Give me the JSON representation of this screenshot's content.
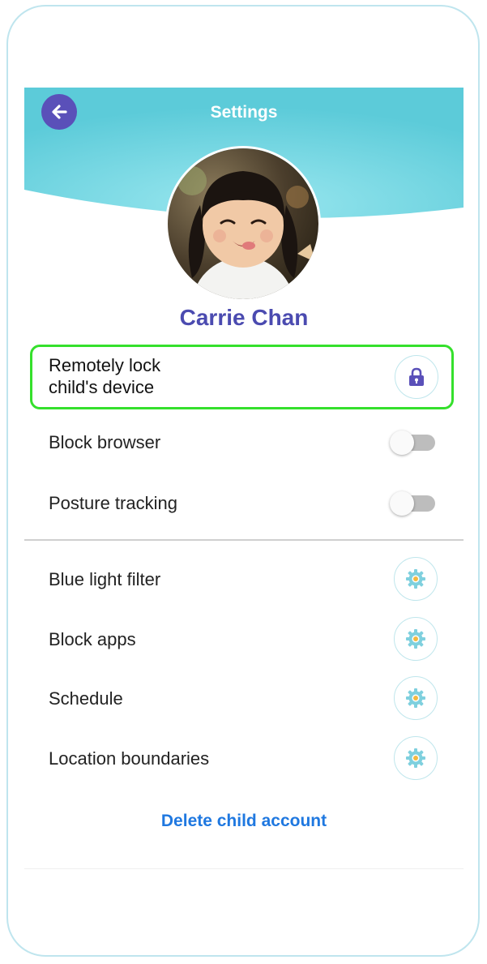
{
  "header": {
    "title": "Settings",
    "back_icon": "arrow-left-icon",
    "gradient_colors": [
      "#5ec9d8",
      "#8ce0ea"
    ]
  },
  "profile": {
    "name": "Carrie Chan",
    "avatar_icon": "child-photo"
  },
  "lock_card": {
    "label_line1": "Remotely lock",
    "label_line2": "child's device",
    "icon": "lock-icon",
    "highlight_color": "#35e02c"
  },
  "toggles": [
    {
      "label": "Block browser",
      "on": false
    },
    {
      "label": "Posture tracking",
      "on": false
    }
  ],
  "settings_items": [
    {
      "label": "Blue light filter",
      "icon": "gear-icon"
    },
    {
      "label": "Block apps",
      "icon": "gear-icon"
    },
    {
      "label": "Schedule",
      "icon": "gear-icon"
    },
    {
      "label": "Location boundaries",
      "icon": "gear-icon"
    }
  ],
  "footer": {
    "delete_label": "Delete child account"
  },
  "colors": {
    "accent_purple": "#5a50b9",
    "name_color": "#4b4bb0",
    "link_blue": "#1f78e0",
    "gear_teal": "#7fd0de",
    "gear_center": "#f4b942"
  }
}
